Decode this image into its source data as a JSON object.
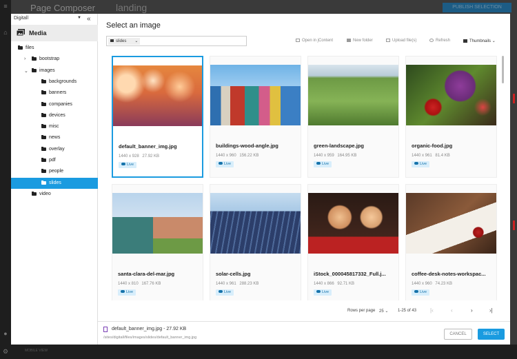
{
  "background": {
    "app_title": "Page Composer",
    "page_name": "landing",
    "publish_label": "PUBLISH SELECTION",
    "footer_hint": "MOBILE VIEW"
  },
  "dialog": {
    "title": "Select an image",
    "site_select": "Digitall",
    "collapse_icon": "«",
    "media_label": "Media",
    "tree": [
      {
        "label": "files",
        "expanded": true
      },
      {
        "label": "bootstrap",
        "expanded": false
      },
      {
        "label": "images",
        "expanded": true
      },
      {
        "label": "backgrounds"
      },
      {
        "label": "banners"
      },
      {
        "label": "companies"
      },
      {
        "label": "devices"
      },
      {
        "label": "misc"
      },
      {
        "label": "news"
      },
      {
        "label": "overlay"
      },
      {
        "label": "pdf"
      },
      {
        "label": "people"
      },
      {
        "label": "slides",
        "selected": true
      },
      {
        "label": "video"
      }
    ],
    "breadcrumb": "slides",
    "toolbar": {
      "open_jcontent": "Open in jContent",
      "new_folder": "New folder",
      "upload": "Upload file(s)",
      "refresh": "Refresh",
      "view_mode": "Thumbnails"
    },
    "cards": [
      {
        "name": "default_banner_img.jpg",
        "dims": "1440 x 928",
        "size": "27.92 KB",
        "status": "Live",
        "selected": true
      },
      {
        "name": "buildings-wood-angle.jpg",
        "dims": "1440 x 960",
        "size": "156.22 KB",
        "status": "Live"
      },
      {
        "name": "green-landscape.jpg",
        "dims": "1440 x 959",
        "size": "164.95 KB",
        "status": "Live"
      },
      {
        "name": "organic-food.jpg",
        "dims": "1440 x 961",
        "size": "81.4 KB",
        "status": "Live"
      },
      {
        "name": "santa-clara-del-mar.jpg",
        "dims": "1440 x 810",
        "size": "167.76 KB",
        "status": "Live"
      },
      {
        "name": "solar-cells.jpg",
        "dims": "1440 x 961",
        "size": "288.23 KB",
        "status": "Live"
      },
      {
        "name": "iStock_000045817332_Full.j...",
        "dims": "1440 x 866",
        "size": "92.71 KB",
        "status": "Live"
      },
      {
        "name": "coffee-desk-notes-workspac...",
        "dims": "1440 x 960",
        "size": "74.23 KB",
        "status": "Live"
      }
    ],
    "pagination": {
      "rows_label": "Rows per page",
      "rows_value": "25",
      "range": "1-25 of 43"
    },
    "footer": {
      "selected_name": "default_banner_img.jpg",
      "selected_size": "27.92 KB",
      "selected_path": "/sites/digitall/files/images/slides/default_banner_img.jpg",
      "cancel_label": "CANCEL",
      "select_label": "SELECT"
    }
  },
  "colors": {
    "accent": "#1a9be0",
    "live_badge_bg": "#d8eefb",
    "live_badge_text": "#1673ab"
  }
}
